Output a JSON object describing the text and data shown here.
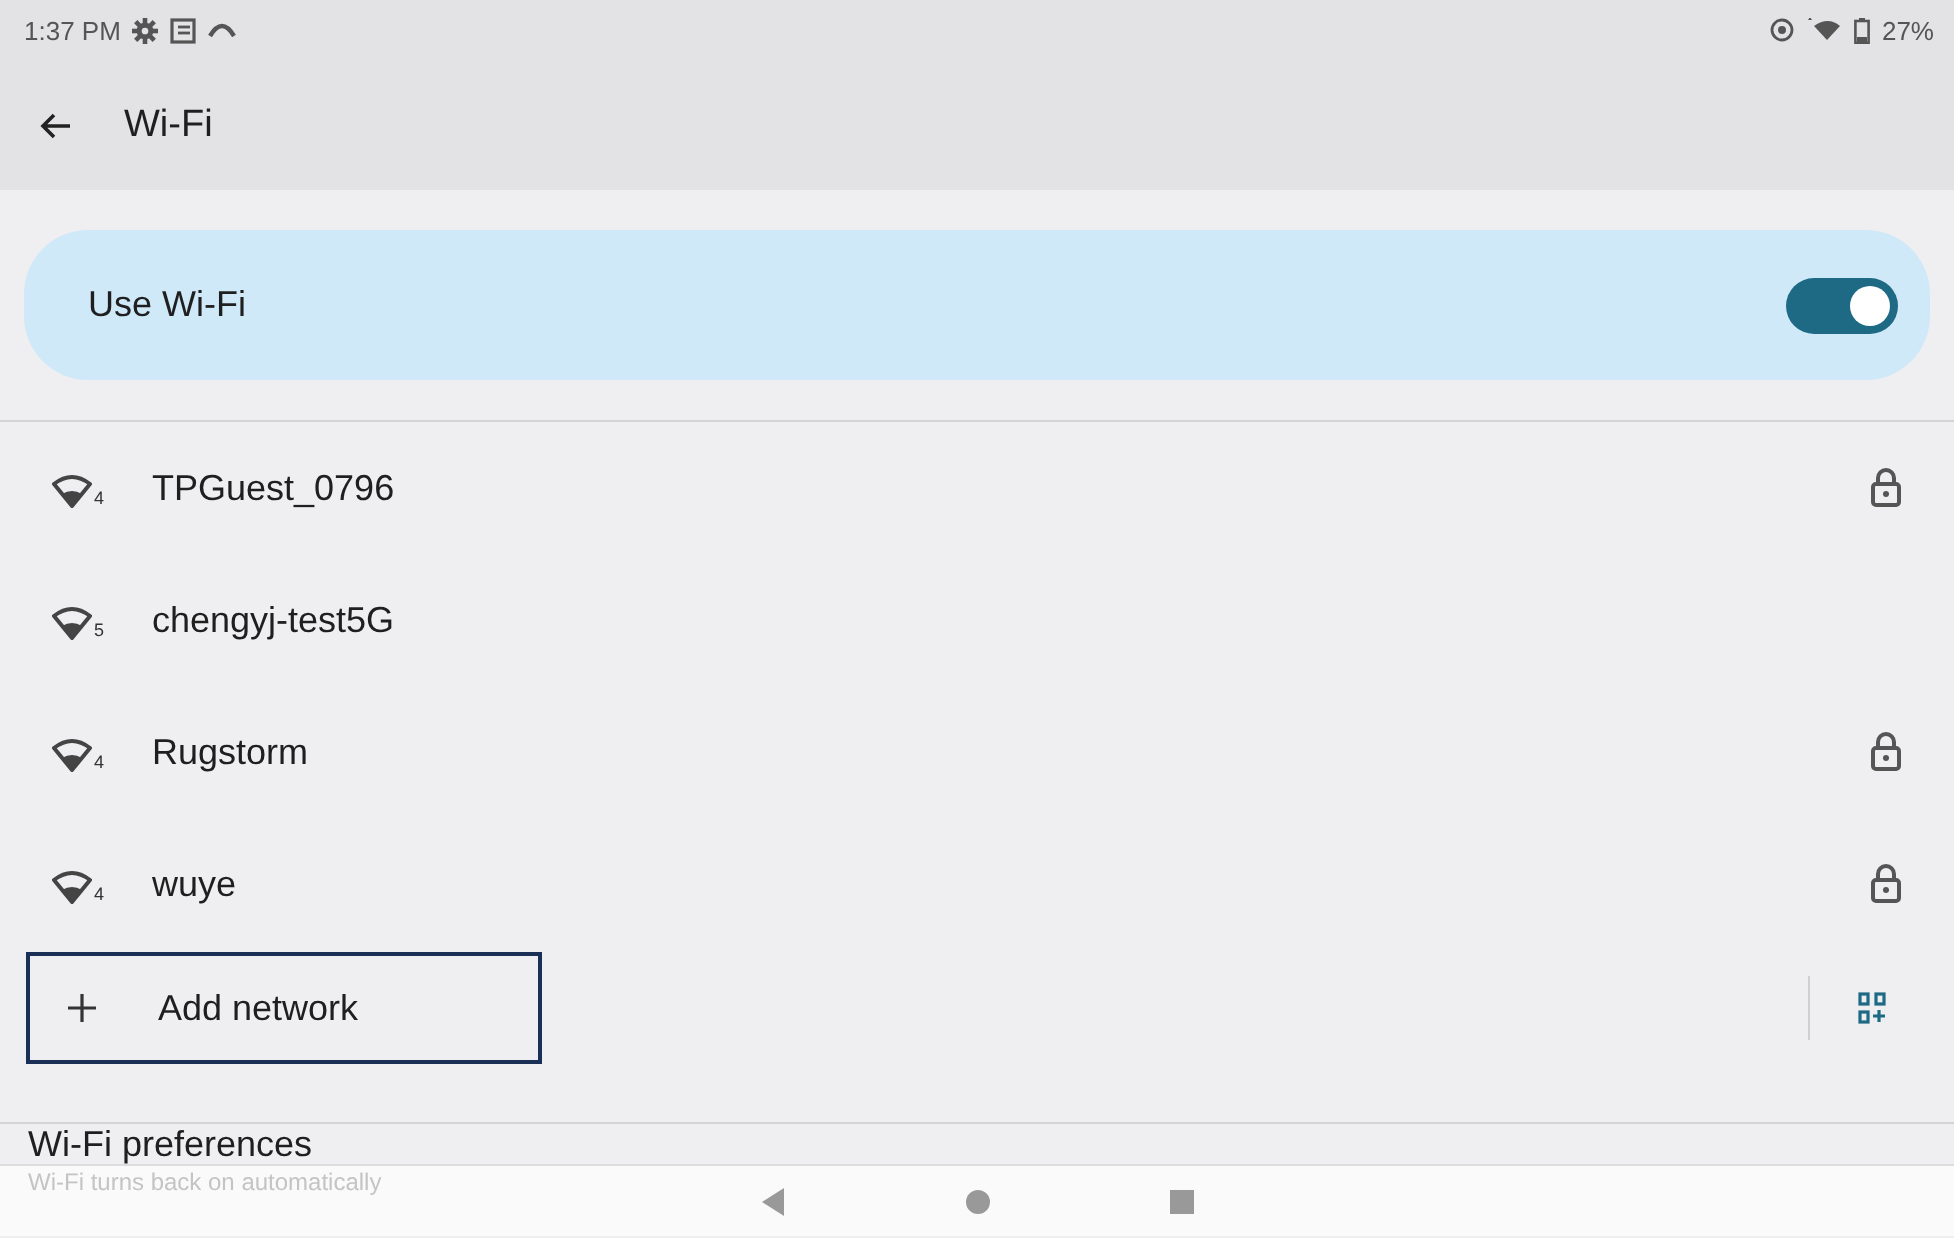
{
  "status_bar": {
    "time": "1:37 PM",
    "battery": "27%"
  },
  "toolbar": {
    "title": "Wi-Fi"
  },
  "master_switch": {
    "label": "Use Wi-Fi",
    "on": true
  },
  "networks": [
    {
      "name": "TPGuest_0796",
      "wifi_generation": "4",
      "secured": true
    },
    {
      "name": "chengyj-test5G",
      "wifi_generation": "5",
      "secured": false
    },
    {
      "name": "Rugstorm",
      "wifi_generation": "4",
      "secured": true
    },
    {
      "name": "wuye",
      "wifi_generation": "4",
      "secured": true
    }
  ],
  "add_network": {
    "label": "Add network",
    "focused": true
  },
  "preferences": {
    "title": "Wi-Fi preferences",
    "summary": "Wi-Fi turns back on automatically"
  }
}
